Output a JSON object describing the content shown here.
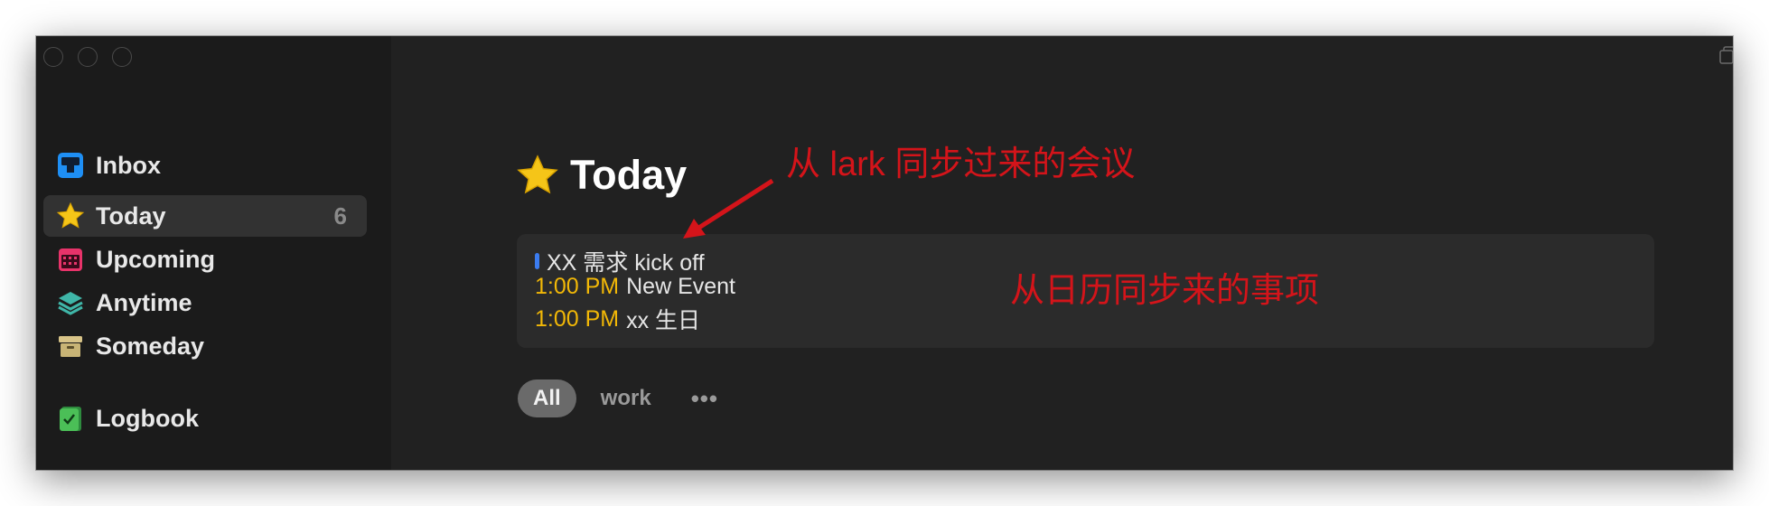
{
  "sidebar": {
    "items": [
      {
        "label": "Inbox",
        "icon": "inbox-icon",
        "count": ""
      },
      {
        "label": "Today",
        "icon": "star-icon",
        "count": "6"
      },
      {
        "label": "Upcoming",
        "icon": "calendar-icon",
        "count": ""
      },
      {
        "label": "Anytime",
        "icon": "layers-icon",
        "count": ""
      },
      {
        "label": "Someday",
        "icon": "archive-box-icon",
        "count": ""
      },
      {
        "label": "Logbook",
        "icon": "logbook-icon",
        "count": ""
      }
    ]
  },
  "main": {
    "title": "Today",
    "events": [
      {
        "time": "",
        "title": "XX 需求 kick off"
      },
      {
        "time": "1:00 PM",
        "title": "New Event"
      },
      {
        "time": "1:00 PM",
        "title": "xx 生日"
      }
    ],
    "tags": [
      "All",
      "work",
      "•••"
    ]
  },
  "annotations": {
    "lark": "从 lark 同步过来的会议",
    "calendar": "从日历同步来的事项"
  },
  "colors": {
    "annotation": "#d4141a",
    "time": "#f2b807",
    "event_bar": "#3b7cf0",
    "selected_bg": "#323232"
  }
}
